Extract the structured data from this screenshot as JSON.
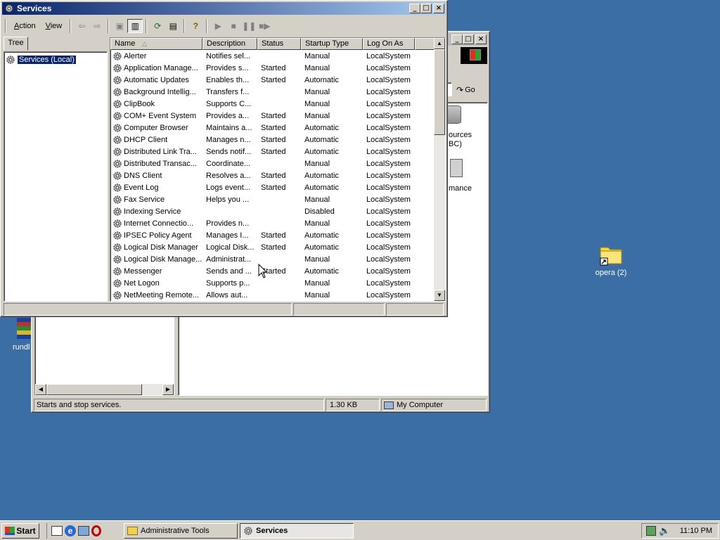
{
  "desktop": {
    "icons": [
      {
        "label": "opera (2)",
        "icon": "folder-shortcut-icon"
      }
    ],
    "partial_label": "rundl"
  },
  "back_window": {
    "partial_labels": [
      "ources",
      "BC)",
      "mance"
    ],
    "go_label": "Go",
    "status_text": "Starts and stop services.",
    "status_size": "1.30 KB",
    "status_zone": "My Computer"
  },
  "services_window": {
    "title": "Services",
    "menu": [
      {
        "label": "Action",
        "accel": "A"
      },
      {
        "label": "View",
        "accel": "V"
      }
    ],
    "tree_tab": "Tree",
    "tree_root": "Services (Local)",
    "columns": [
      "Name",
      "Description",
      "Status",
      "Startup Type",
      "Log On As"
    ],
    "rows": [
      [
        "Alerter",
        "Notifies sel...",
        "",
        "Manual",
        "LocalSystem"
      ],
      [
        "Application Manage...",
        "Provides s...",
        "Started",
        "Manual",
        "LocalSystem"
      ],
      [
        "Automatic Updates",
        "Enables th...",
        "Started",
        "Automatic",
        "LocalSystem"
      ],
      [
        "Background Intellig...",
        "Transfers f...",
        "",
        "Manual",
        "LocalSystem"
      ],
      [
        "ClipBook",
        "Supports C...",
        "",
        "Manual",
        "LocalSystem"
      ],
      [
        "COM+ Event System",
        "Provides a...",
        "Started",
        "Manual",
        "LocalSystem"
      ],
      [
        "Computer Browser",
        "Maintains a...",
        "Started",
        "Automatic",
        "LocalSystem"
      ],
      [
        "DHCP Client",
        "Manages n...",
        "Started",
        "Automatic",
        "LocalSystem"
      ],
      [
        "Distributed Link Tra...",
        "Sends notif...",
        "Started",
        "Automatic",
        "LocalSystem"
      ],
      [
        "Distributed Transac...",
        "Coordinate...",
        "",
        "Manual",
        "LocalSystem"
      ],
      [
        "DNS Client",
        "Resolves a...",
        "Started",
        "Automatic",
        "LocalSystem"
      ],
      [
        "Event Log",
        "Logs event...",
        "Started",
        "Automatic",
        "LocalSystem"
      ],
      [
        "Fax Service",
        "Helps you ...",
        "",
        "Manual",
        "LocalSystem"
      ],
      [
        "Indexing Service",
        "",
        "",
        "Disabled",
        "LocalSystem"
      ],
      [
        "Internet Connectio...",
        "Provides n...",
        "",
        "Manual",
        "LocalSystem"
      ],
      [
        "IPSEC Policy Agent",
        "Manages I...",
        "Started",
        "Automatic",
        "LocalSystem"
      ],
      [
        "Logical Disk Manager",
        "Logical Disk...",
        "Started",
        "Automatic",
        "LocalSystem"
      ],
      [
        "Logical Disk Manage...",
        "Administrat...",
        "",
        "Manual",
        "LocalSystem"
      ],
      [
        "Messenger",
        "Sends and ...",
        "Started",
        "Automatic",
        "LocalSystem"
      ],
      [
        "Net Logon",
        "Supports p...",
        "",
        "Manual",
        "LocalSystem"
      ],
      [
        "NetMeeting Remote...",
        "Allows aut...",
        "",
        "Manual",
        "LocalSystem"
      ]
    ]
  },
  "taskbar": {
    "start_label": "Start",
    "tasks": [
      {
        "label": "Administrative Tools",
        "active": false
      },
      {
        "label": "Services",
        "active": true
      }
    ],
    "clock": "11:10 PM"
  },
  "colors": {
    "desktop": "#3a6ea5",
    "title_active": "#0a246a",
    "selection": "#0a246a"
  }
}
